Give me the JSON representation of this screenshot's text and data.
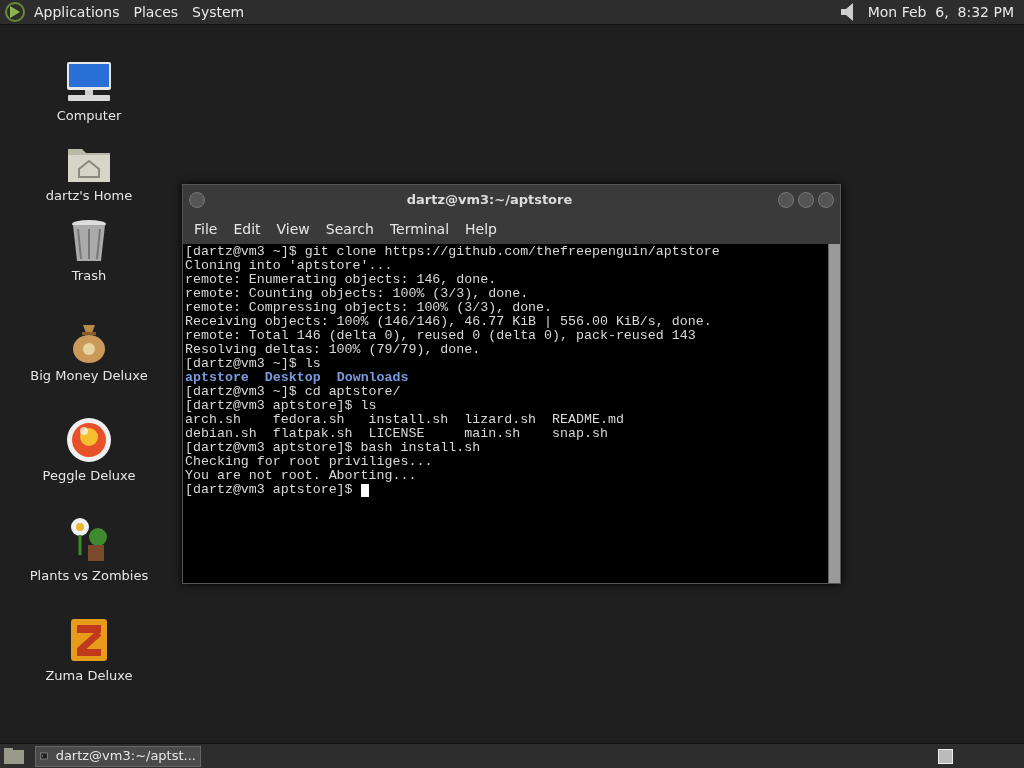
{
  "top_panel": {
    "menus": [
      "Applications",
      "Places",
      "System"
    ],
    "clock": "Mon Feb  6,  8:32 PM"
  },
  "desktop_icons": [
    {
      "kind": "computer",
      "label": "Computer"
    },
    {
      "kind": "home",
      "label": "dartz's Home"
    },
    {
      "kind": "trash",
      "label": "Trash"
    },
    {
      "kind": "money",
      "label": "Big Money Deluxe"
    },
    {
      "kind": "peggle",
      "label": "Peggle Deluxe"
    },
    {
      "kind": "plants",
      "label": "Plants vs Zombies"
    },
    {
      "kind": "zuma",
      "label": "Zuma Deluxe"
    }
  ],
  "window": {
    "title": "dartz@vm3:~/aptstore",
    "menus": [
      "File",
      "Edit",
      "View",
      "Search",
      "Terminal",
      "Help"
    ],
    "terminal": {
      "cursor_visible": true,
      "lines": [
        {
          "kind": "text",
          "text": "[dartz@vm3 ~]$ git clone https://github.com/thefreepenguin/aptstore"
        },
        {
          "kind": "text",
          "text": "Cloning into 'aptstore'..."
        },
        {
          "kind": "text",
          "text": "remote: Enumerating objects: 146, done."
        },
        {
          "kind": "text",
          "text": "remote: Counting objects: 100% (3/3), done."
        },
        {
          "kind": "text",
          "text": "remote: Compressing objects: 100% (3/3), done."
        },
        {
          "kind": "text",
          "text": "Receiving objects: 100% (146/146), 46.77 KiB | 556.00 KiB/s, done."
        },
        {
          "kind": "text",
          "text": "remote: Total 146 (delta 0), reused 0 (delta 0), pack-reused 143"
        },
        {
          "kind": "text",
          "text": "Resolving deltas: 100% (79/79), done."
        },
        {
          "kind": "text",
          "text": "[dartz@vm3 ~]$ ls"
        },
        {
          "kind": "dirs",
          "items": [
            "aptstore",
            "Desktop",
            "Downloads"
          ]
        },
        {
          "kind": "text",
          "text": "[dartz@vm3 ~]$ cd aptstore/"
        },
        {
          "kind": "text",
          "text": "[dartz@vm3 aptstore]$ ls"
        },
        {
          "kind": "text",
          "text": "arch.sh    fedora.sh   install.sh  lizard.sh  README.md"
        },
        {
          "kind": "text",
          "text": "debian.sh  flatpak.sh  LICENSE     main.sh    snap.sh"
        },
        {
          "kind": "text",
          "text": "[dartz@vm3 aptstore]$ bash install.sh"
        },
        {
          "kind": "text",
          "text": "Checking for root priviliges..."
        },
        {
          "kind": "text",
          "text": "You are not root. Aborting..."
        },
        {
          "kind": "text",
          "text": "[dartz@vm3 aptstore]$ "
        }
      ]
    }
  },
  "taskbar": {
    "tasks": [
      {
        "label": "dartz@vm3:~/aptst...",
        "selected": true
      }
    ]
  }
}
